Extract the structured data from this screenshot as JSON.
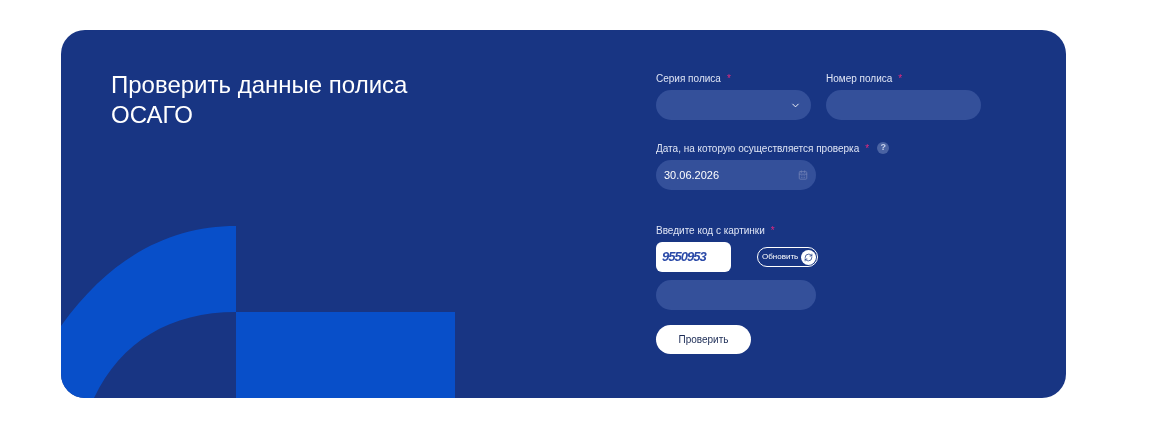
{
  "title": "Проверить данные полиса ОСАГО",
  "series_field": {
    "label": "Серия полиса",
    "required_mark": "*"
  },
  "number_field": {
    "label": "Номер полиса",
    "required_mark": "*"
  },
  "date_field": {
    "label": "Дата, на которую осуществляется проверка",
    "required_mark": "*",
    "help": "?",
    "value": "30.06.2026"
  },
  "captcha": {
    "label": "Введите код с картинки",
    "required_mark": "*",
    "code": "9550953",
    "refresh_button": "Обновить"
  },
  "submit_button": "Проверить"
}
